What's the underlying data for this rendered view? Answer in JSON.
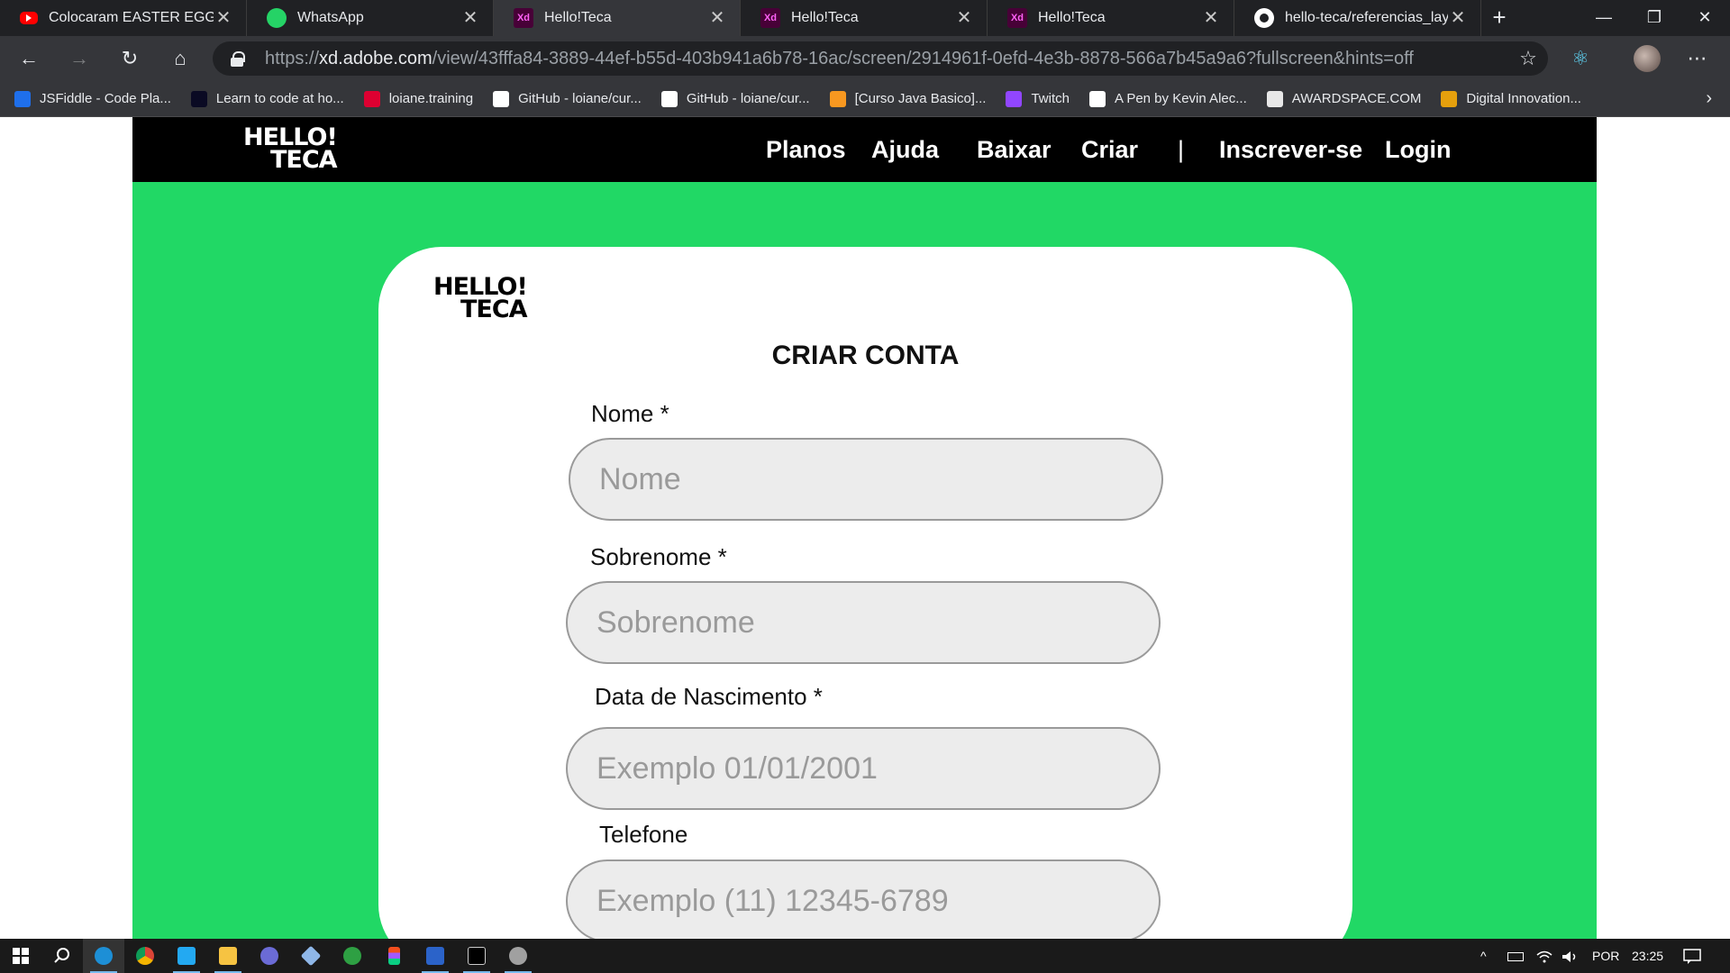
{
  "browser": {
    "tabs": [
      {
        "label": "Colocaram EASTER EGG na D",
        "icon": "youtube-icon",
        "active": false
      },
      {
        "label": "WhatsApp",
        "icon": "whatsapp-icon",
        "active": false
      },
      {
        "label": "Hello!Teca",
        "icon": "adobe-xd-icon",
        "active": true
      },
      {
        "label": "Hello!Teca",
        "icon": "adobe-xd-icon",
        "active": false
      },
      {
        "label": "Hello!Teca",
        "icon": "adobe-xd-icon",
        "active": false
      },
      {
        "label": "hello-teca/referencias_layout",
        "icon": "github-icon",
        "active": false
      }
    ],
    "xd_badge": "Xd",
    "new_tab": "+",
    "close_glyph": "✕",
    "window_controls": {
      "minimize": "—",
      "restore": "❐",
      "close": "✕"
    },
    "nav": {
      "back": "←",
      "forward": "→",
      "reload": "↻",
      "home": "⌂"
    },
    "url": {
      "scheme": "https://",
      "host": "xd.adobe.com",
      "path": "/view/43fffa84-3889-44ef-b55d-403b941a6b78-16ac/screen/2914961f-0efd-4e3b-8878-566a7b45a9a6?fullscreen&hints=off"
    },
    "favorite_glyph": "☆",
    "extension_glyph": "⚛",
    "menu_glyph": "⋯",
    "bookmarks": [
      {
        "label": "JSFiddle - Code Pla...",
        "color": "#1f6feb"
      },
      {
        "label": "Learn to code at ho...",
        "color": "#0a0a23"
      },
      {
        "label": "loiane.training",
        "color": "#dd0031"
      },
      {
        "label": "GitHub - loiane/cur...",
        "color": "#ffffff"
      },
      {
        "label": "GitHub - loiane/cur...",
        "color": "#ffffff"
      },
      {
        "label": "[Curso Java Basico]...",
        "color": "#f89820"
      },
      {
        "label": "Twitch",
        "color": "#9146ff"
      },
      {
        "label": "A Pen by Kevin Alec...",
        "color": "#ffffff"
      },
      {
        "label": "AWARDSPACE.COM",
        "color": "#e8e8e8"
      },
      {
        "label": "Digital Innovation...",
        "color": "#e5a00d"
      }
    ],
    "bookmarks_more": "›"
  },
  "site": {
    "logo_line1": "HELLO!",
    "logo_line2": "TECA",
    "nav": {
      "planos": "Planos",
      "ajuda": "Ajuda",
      "baixar": "Baixar",
      "criar": "Criar",
      "divider": "|",
      "inscrever": "Inscrever-se",
      "login": "Login"
    },
    "colors": {
      "background": "#21d865",
      "header": "#000000",
      "card": "#ffffff"
    }
  },
  "form": {
    "title": "CRIAR CONTA",
    "fields": {
      "nome": {
        "label": "Nome *",
        "placeholder": "Nome",
        "value": ""
      },
      "sobrenome": {
        "label": "Sobrenome *",
        "placeholder": "Sobrenome",
        "value": ""
      },
      "nascimento": {
        "label": "Data de Nascimento *",
        "placeholder": "Exemplo 01/01/2001",
        "value": ""
      },
      "telefone": {
        "label": "Telefone",
        "placeholder": "Exemplo (11) 12345-6789",
        "value": ""
      }
    }
  },
  "taskbar": {
    "apps": [
      "windows-start-icon",
      "search-icon",
      "edge-icon",
      "chrome-icon",
      "vscode-icon",
      "file-explorer-icon",
      "app-icon",
      "app-icon",
      "app-icon",
      "figma-icon",
      "app-icon",
      "terminal-icon",
      "app-icon"
    ],
    "tray": {
      "chevron": "^",
      "language": "POR",
      "time": "23:25"
    }
  }
}
